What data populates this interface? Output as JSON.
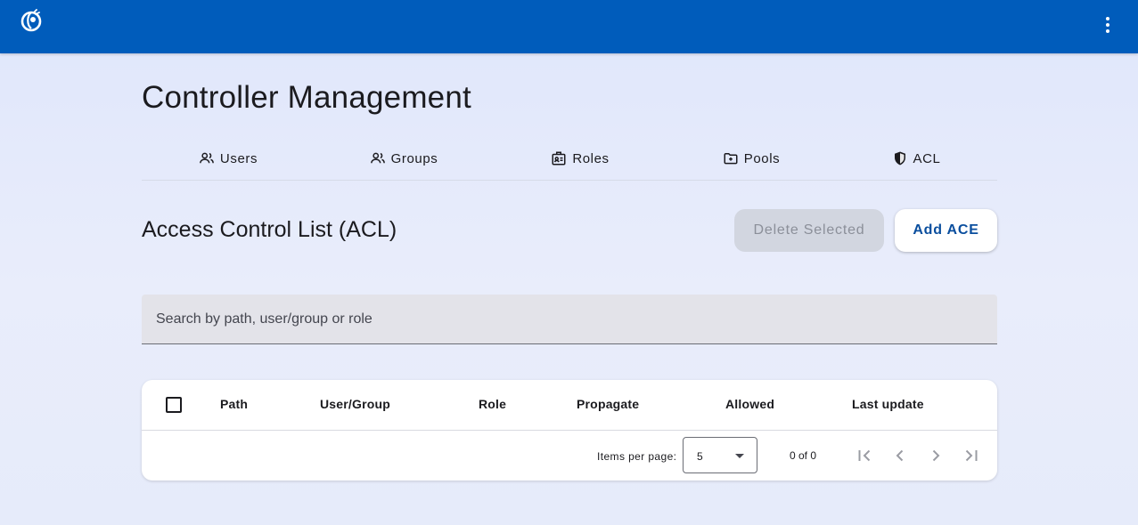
{
  "header": {
    "logo_icon": "app-logo",
    "menu_icon": "more-vert-icon",
    "bar_color": "#005cbb"
  },
  "page": {
    "title": "Controller Management"
  },
  "tabs": [
    {
      "label": "Users",
      "icon": "users-icon"
    },
    {
      "label": "Groups",
      "icon": "groups-icon"
    },
    {
      "label": "Roles",
      "icon": "roles-icon"
    },
    {
      "label": "Pools",
      "icon": "pools-icon"
    },
    {
      "label": "ACL",
      "icon": "shield-icon",
      "active": true
    }
  ],
  "section": {
    "title": "Access Control List (ACL)",
    "delete_label": "Delete Selected",
    "add_label": "Add ACE"
  },
  "search": {
    "placeholder": "Search by path, user/group or role",
    "value": ""
  },
  "table": {
    "columns": [
      "Path",
      "User/Group",
      "Role",
      "Propagate",
      "Allowed",
      "Last update"
    ],
    "rows": []
  },
  "paginator": {
    "items_per_page_label": "Items per page:",
    "items_per_page": "5",
    "range_label": "0 of 0"
  },
  "colors": {
    "accent": "#005cbb",
    "primary_text_button": "#0a4e9e",
    "disabled_button_bg": "#d2d6e0"
  }
}
